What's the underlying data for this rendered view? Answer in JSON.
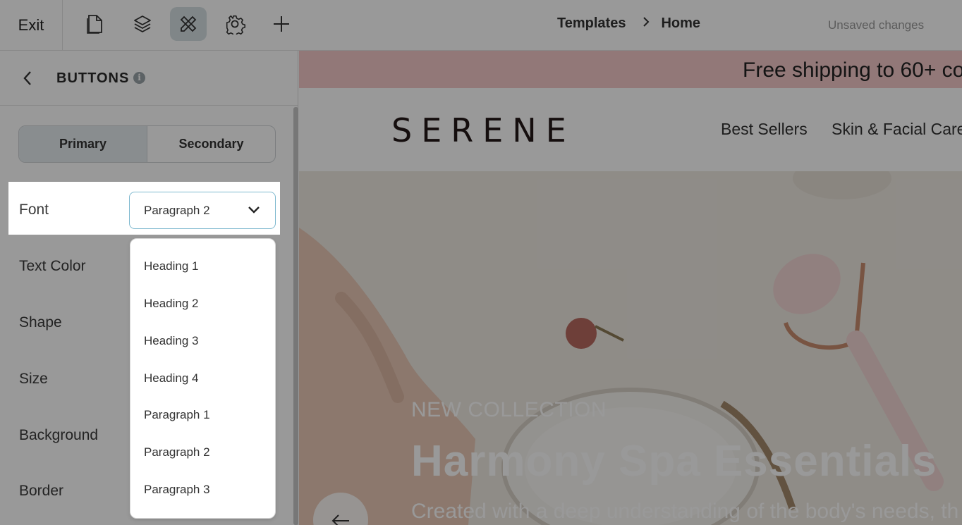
{
  "topbar": {
    "exit_label": "Exit",
    "tools": [
      {
        "name": "pages-icon",
        "active": false
      },
      {
        "name": "layers-icon",
        "active": false
      },
      {
        "name": "design-tools-icon",
        "active": true
      },
      {
        "name": "gear-icon",
        "active": false
      },
      {
        "name": "plus-icon",
        "active": false
      }
    ],
    "breadcrumb": {
      "parent": "Templates",
      "current": "Home"
    },
    "status": "Unsaved changes"
  },
  "sidebar": {
    "title": "BUTTONS",
    "info_glyph": "i",
    "tabs": [
      {
        "label": "Primary",
        "active": true
      },
      {
        "label": "Secondary",
        "active": false
      }
    ],
    "font": {
      "label": "Font",
      "selected": "Paragraph 2",
      "options": [
        "Heading 1",
        "Heading 2",
        "Heading 3",
        "Heading 4",
        "Paragraph 1",
        "Paragraph 2",
        "Paragraph 3"
      ]
    },
    "settings": [
      "Text Color",
      "Shape",
      "Size",
      "Background",
      "Border"
    ]
  },
  "preview": {
    "banner_text": "Free shipping to 60+ co",
    "banner_color": "#f3c9c9",
    "logo": "SERENE",
    "nav_links": [
      "Best Sellers",
      "Skin & Facial Care"
    ],
    "hero": {
      "eyebrow": "NEW COLLECTION",
      "title": "Harmony Spa Essentials",
      "subtitle": "Created with a deep understanding of the body's needs, th"
    }
  },
  "colors": {
    "accent_border": "#7fb9cf",
    "active_tab": "#e4ecef",
    "overlay": "rgba(0,0,0,0.4)"
  }
}
